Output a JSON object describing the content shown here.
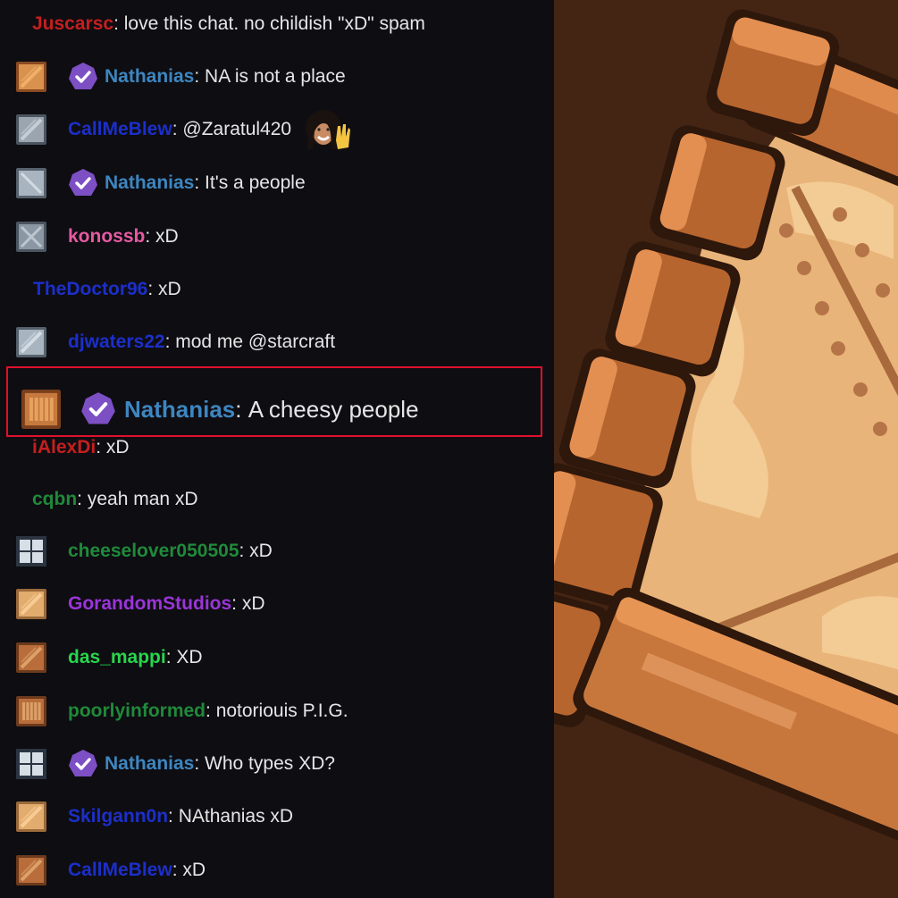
{
  "chat": {
    "separator": ": ",
    "messages": [
      {
        "user": "Juscarsc",
        "color": "#c51f1f",
        "text": "love this chat. no childish \"xD\" spam",
        "avatar": "none",
        "verified": false
      },
      {
        "user": "Nathanias",
        "color": "#3d86c0",
        "text": "NA is not a place",
        "avatar": "crate-orange",
        "verified": true
      },
      {
        "user": "CallMeBlew",
        "color": "#1c2fc9",
        "text": "@Zaratul420",
        "avatar": "crate-steel",
        "verified": false,
        "emote": "waving-woman-emote"
      },
      {
        "user": "Nathanias",
        "color": "#3d86c0",
        "text": "It's a people",
        "avatar": "crate-steel-light",
        "verified": true
      },
      {
        "user": "konossb",
        "color": "#e65aa2",
        "text": "xD",
        "avatar": "crate-steel-x",
        "verified": false
      },
      {
        "user": "TheDoctor96",
        "color": "#1c2fc9",
        "text": "xD",
        "avatar": "none",
        "verified": false
      },
      {
        "user": "djwaters22",
        "color": "#1c2fc9",
        "text": "mod me @starcraft",
        "avatar": "crate-steel-diag",
        "verified": false
      },
      {
        "user": "Nathanias",
        "color": "#3d86c0",
        "text": "A cheesy people",
        "avatar": "crate-wood-slats",
        "verified": true,
        "highlighted": true
      },
      {
        "user": "iAlexDi",
        "color": "#c51f1f",
        "text": "xD",
        "avatar": "none",
        "verified": false
      },
      {
        "user": "cqbn",
        "color": "#1f8a3a",
        "text": "yeah man xD",
        "avatar": "none",
        "verified": false
      },
      {
        "user": "cheeselover050505",
        "color": "#1f8a3a",
        "text": "xD",
        "avatar": "steel-window",
        "verified": false
      },
      {
        "user": "GorandomStudios",
        "color": "#9a35d8",
        "text": "xD",
        "avatar": "crate-tan-diag",
        "verified": false
      },
      {
        "user": "das_mappi",
        "color": "#27d64b",
        "text": "XD",
        "avatar": "crate-brown-diag",
        "verified": false
      },
      {
        "user": "poorlyinformed",
        "color": "#1f8a3a",
        "text": "notoriouis P.I.G.",
        "avatar": "crate-brown-slats",
        "verified": false
      },
      {
        "user": "Nathanias",
        "color": "#3d86c0",
        "text": "Who types XD?",
        "avatar": "steel-window",
        "verified": true
      },
      {
        "user": "Skilgann0n",
        "color": "#1c2fc9",
        "text": "NAthanias xD",
        "avatar": "crate-tan-diag",
        "verified": false
      },
      {
        "user": "CallMeBlew",
        "color": "#1c2fc9",
        "text": "xD",
        "avatar": "crate-brown-diag",
        "verified": false
      }
    ]
  },
  "art": {
    "name": "wooden-crate-artwork"
  }
}
